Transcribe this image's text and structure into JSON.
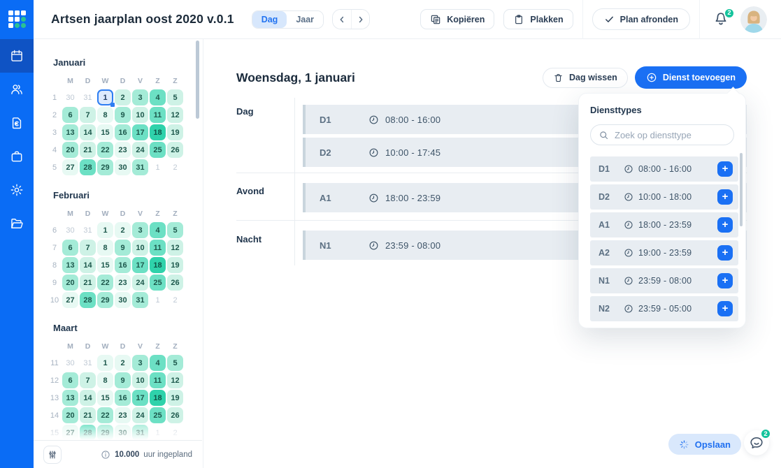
{
  "topbar": {
    "title": "Artsen jaarplan oost 2020 v.0.1",
    "view_options": [
      {
        "label": "Dag",
        "active": true
      },
      {
        "label": "Jaar",
        "active": false
      }
    ],
    "copy_label": "Kopiëren",
    "paste_label": "Plakken",
    "finish_label": "Plan afronden",
    "notification_count": "2"
  },
  "sidebar": {
    "items": [
      {
        "icon": "calendar-icon",
        "active": true
      },
      {
        "icon": "users-icon",
        "active": false
      },
      {
        "icon": "invoice-euro-icon",
        "active": false
      },
      {
        "icon": "briefcase-icon",
        "active": false
      },
      {
        "icon": "settings-icon",
        "active": false
      },
      {
        "icon": "folder-icon",
        "active": false
      }
    ]
  },
  "calendar_panel": {
    "weekday_headers": [
      "M",
      "D",
      "W",
      "D",
      "V",
      "Z",
      "Z"
    ],
    "day_shade_legend": {
      "o": "outside-month",
      "s": "selected",
      "1": "#e7f9f3",
      "2": "#cef2e6",
      "3": "#a4ebd7",
      "4": "#6ce0c4",
      "5": "#2fd2ab"
    },
    "months": [
      {
        "name": "Januari",
        "week_numbers": [
          "1",
          "2",
          "3",
          "4",
          "5"
        ],
        "weeks": [
          [
            [
              "30",
              "o"
            ],
            [
              "31",
              "o"
            ],
            [
              "1",
              "s"
            ],
            [
              "2",
              "2"
            ],
            [
              "3",
              "3"
            ],
            [
              "4",
              "4"
            ],
            [
              "5",
              "2"
            ]
          ],
          [
            [
              "6",
              "3"
            ],
            [
              "7",
              "2"
            ],
            [
              "8",
              "1"
            ],
            [
              "9",
              "3"
            ],
            [
              "10",
              "2"
            ],
            [
              "11",
              "4"
            ],
            [
              "12",
              "2"
            ]
          ],
          [
            [
              "13",
              "3"
            ],
            [
              "14",
              "2"
            ],
            [
              "15",
              "1"
            ],
            [
              "16",
              "3"
            ],
            [
              "17",
              "4"
            ],
            [
              "18",
              "5"
            ],
            [
              "19",
              "2"
            ]
          ],
          [
            [
              "20",
              "3"
            ],
            [
              "21",
              "2"
            ],
            [
              "22",
              "3"
            ],
            [
              "23",
              "1"
            ],
            [
              "24",
              "2"
            ],
            [
              "25",
              "4"
            ],
            [
              "26",
              "2"
            ]
          ],
          [
            [
              "27",
              "1"
            ],
            [
              "28",
              "4"
            ],
            [
              "29",
              "3"
            ],
            [
              "30",
              "1"
            ],
            [
              "31",
              "3"
            ],
            [
              "1",
              "o"
            ],
            [
              "2",
              "o"
            ]
          ]
        ]
      },
      {
        "name": "Februari",
        "week_numbers": [
          "6",
          "7",
          "8",
          "9",
          "10"
        ],
        "weeks": [
          [
            [
              "30",
              "o"
            ],
            [
              "31",
              "o"
            ],
            [
              "1",
              "1"
            ],
            [
              "2",
              "1"
            ],
            [
              "3",
              "3"
            ],
            [
              "4",
              "4"
            ],
            [
              "5",
              "3"
            ]
          ],
          [
            [
              "6",
              "3"
            ],
            [
              "7",
              "2"
            ],
            [
              "8",
              "1"
            ],
            [
              "9",
              "3"
            ],
            [
              "10",
              "2"
            ],
            [
              "11",
              "4"
            ],
            [
              "12",
              "2"
            ]
          ],
          [
            [
              "13",
              "3"
            ],
            [
              "14",
              "2"
            ],
            [
              "15",
              "1"
            ],
            [
              "16",
              "3"
            ],
            [
              "17",
              "4"
            ],
            [
              "18",
              "5"
            ],
            [
              "19",
              "2"
            ]
          ],
          [
            [
              "20",
              "3"
            ],
            [
              "21",
              "2"
            ],
            [
              "22",
              "3"
            ],
            [
              "23",
              "1"
            ],
            [
              "24",
              "2"
            ],
            [
              "25",
              "4"
            ],
            [
              "26",
              "2"
            ]
          ],
          [
            [
              "27",
              "1"
            ],
            [
              "28",
              "4"
            ],
            [
              "29",
              "3"
            ],
            [
              "30",
              "1"
            ],
            [
              "31",
              "3"
            ],
            [
              "1",
              "o"
            ],
            [
              "2",
              "o"
            ]
          ]
        ]
      },
      {
        "name": "Maart",
        "week_numbers": [
          "11",
          "12",
          "13",
          "14",
          "15"
        ],
        "weeks": [
          [
            [
              "30",
              "o"
            ],
            [
              "31",
              "o"
            ],
            [
              "1",
              "1"
            ],
            [
              "2",
              "1"
            ],
            [
              "3",
              "3"
            ],
            [
              "4",
              "4"
            ],
            [
              "5",
              "3"
            ]
          ],
          [
            [
              "6",
              "3"
            ],
            [
              "7",
              "2"
            ],
            [
              "8",
              "1"
            ],
            [
              "9",
              "3"
            ],
            [
              "10",
              "2"
            ],
            [
              "11",
              "4"
            ],
            [
              "12",
              "2"
            ]
          ],
          [
            [
              "13",
              "3"
            ],
            [
              "14",
              "2"
            ],
            [
              "15",
              "1"
            ],
            [
              "16",
              "3"
            ],
            [
              "17",
              "4"
            ],
            [
              "18",
              "5"
            ],
            [
              "19",
              "2"
            ]
          ],
          [
            [
              "20",
              "3"
            ],
            [
              "21",
              "2"
            ],
            [
              "22",
              "3"
            ],
            [
              "23",
              "1"
            ],
            [
              "24",
              "2"
            ],
            [
              "25",
              "4"
            ],
            [
              "26",
              "2"
            ]
          ],
          [
            [
              "27",
              "1"
            ],
            [
              "28",
              "4"
            ],
            [
              "29",
              "3"
            ],
            [
              "30",
              "1"
            ],
            [
              "31",
              "3"
            ],
            [
              "1",
              "o"
            ],
            [
              "2",
              "o"
            ]
          ]
        ]
      }
    ],
    "footer": {
      "hours": "10.000",
      "hours_label": "uur ingepland"
    }
  },
  "main": {
    "date_title": "Woensdag, 1 januari",
    "clear_day_label": "Dag wissen",
    "add_shift_label": "Dienst toevoegen",
    "sections": [
      {
        "label": "Dag",
        "shifts": [
          {
            "code": "D1",
            "time": "08:00 - 16:00"
          },
          {
            "code": "D2",
            "time": "10:00 - 17:45"
          }
        ]
      },
      {
        "label": "Avond",
        "shifts": [
          {
            "code": "A1",
            "time": "18:00 - 23:59"
          }
        ]
      },
      {
        "label": "Nacht",
        "shifts": [
          {
            "code": "N1",
            "time": "23:59 - 08:00"
          }
        ]
      }
    ],
    "save_label": "Opslaan",
    "chat_badge": "2"
  },
  "popup": {
    "title": "Diensttypes",
    "search_placeholder": "Zoek op diensttype",
    "items": [
      {
        "code": "D1",
        "time": "08:00 - 16:00"
      },
      {
        "code": "D2",
        "time": "10:00 - 18:00"
      },
      {
        "code": "A1",
        "time": "18:00 - 23:59"
      },
      {
        "code": "A2",
        "time": "19:00 - 23:59"
      },
      {
        "code": "N1",
        "time": "23:59 - 08:00"
      },
      {
        "code": "N2",
        "time": "23:59 - 05:00"
      }
    ]
  },
  "colors": {
    "accent_blue": "#1a70f4",
    "sidebar_blue": "#0a6cf5",
    "sidebar_active": "#0f53c4",
    "badge_green": "#13c39c",
    "selected_day_border": "#2e7ef2",
    "shift_row_bg": "#e8edf2"
  }
}
